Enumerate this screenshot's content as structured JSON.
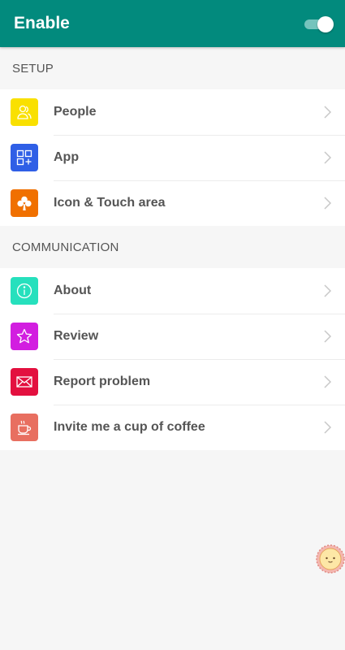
{
  "appbar": {
    "title": "Enable",
    "toggle_on": true
  },
  "sections": {
    "setup": {
      "header": "SETUP",
      "items": [
        {
          "label": "People",
          "icon": "people-icon",
          "color": "#f9e000"
        },
        {
          "label": "App",
          "icon": "app-grid-icon",
          "color": "#2f5fe6"
        },
        {
          "label": "Icon & Touch area",
          "icon": "clover-icon",
          "color": "#f07000"
        }
      ]
    },
    "communication": {
      "header": "COMMUNICATION",
      "items": [
        {
          "label": "About",
          "icon": "info-icon",
          "color": "#26e0bd"
        },
        {
          "label": "Review",
          "icon": "star-icon",
          "color": "#d21ee0"
        },
        {
          "label": "Report problem",
          "icon": "mail-icon",
          "color": "#e3103f"
        },
        {
          "label": "Invite me a cup of coffee",
          "icon": "coffee-icon",
          "color": "#e86f60"
        }
      ]
    }
  }
}
